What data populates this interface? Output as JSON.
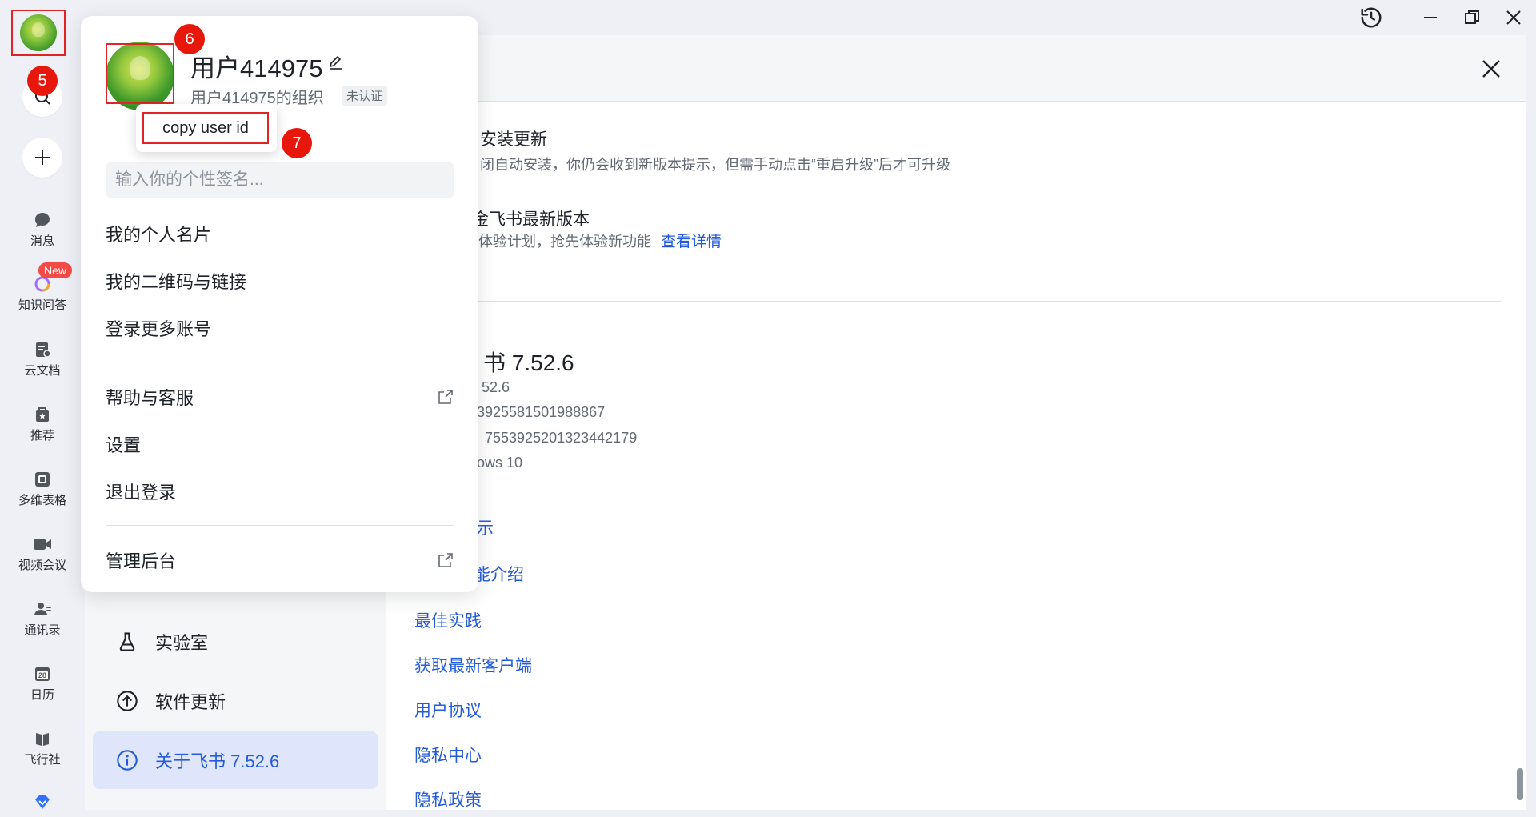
{
  "annotations": {
    "badge5": "5",
    "badge6": "6",
    "badge7": "7"
  },
  "rail": {
    "items": [
      {
        "label": "消息",
        "icon": "chat-bubble-icon"
      },
      {
        "label": "知识问答",
        "icon": "knowledge-qa-icon",
        "badge": "New"
      },
      {
        "label": "云文档",
        "icon": "cloud-doc-icon"
      },
      {
        "label": "推荐",
        "icon": "recommend-icon"
      },
      {
        "label": "多维表格",
        "icon": "base-table-icon"
      },
      {
        "label": "视频会议",
        "icon": "video-camera-icon"
      },
      {
        "label": "通讯录",
        "icon": "contacts-icon"
      },
      {
        "label": "日历",
        "icon": "calendar-icon",
        "calendar_day": "28"
      },
      {
        "label": "飞行社",
        "icon": "flight-club-icon"
      }
    ]
  },
  "profile": {
    "name": "用户414975",
    "org": "用户414975的组织",
    "verify_tag": "未认证",
    "tooltip": "copy user id",
    "signature_placeholder": "输入你的个性签名...",
    "menu_group1": [
      "我的个人名片",
      "我的二维码与链接",
      "登录更多账号"
    ],
    "menu_group2": [
      "帮助与客服",
      "设置",
      "退出登录"
    ],
    "menu_group3": [
      "管理后台"
    ]
  },
  "settings": {
    "nav": [
      {
        "label": "实验室",
        "icon": "flask-icon"
      },
      {
        "label": "软件更新",
        "icon": "arrow-up-circle-icon"
      },
      {
        "label": "关于飞书 7.52.6",
        "icon": "info-circle-icon",
        "active": true
      }
    ],
    "auto_update_title": "安装更新",
    "auto_update_desc": "闭自动安装，你仍会收到新版本提示，但需手动点击“重启升级”后才可升级",
    "beta_title": "金飞书最新版本",
    "beta_desc": "体验计划，抢先体验新功能",
    "beta_link": "查看详情",
    "version_title": "书 7.52.6",
    "version_line": "52.6",
    "id_line1": "3925581501988867",
    "id_line2": "7553925201323442179",
    "os_line": "ows 10",
    "links": [
      "示",
      "能介绍",
      "最佳实践",
      "获取最新客户端",
      "用户协议",
      "隐私中心",
      "隐私政策"
    ]
  }
}
